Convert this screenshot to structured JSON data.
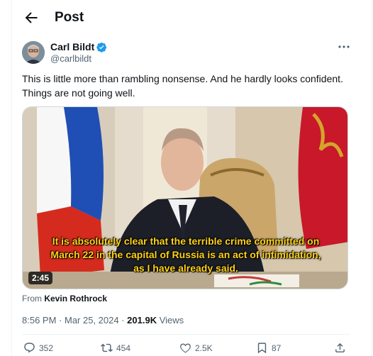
{
  "header": {
    "title": "Post"
  },
  "author": {
    "name": "Carl Bildt",
    "handle": "@carlbildt"
  },
  "tweet": {
    "text": "This is little more than rambling nonsense. And he hardly looks confident. Things are not going well."
  },
  "media": {
    "subtitle_lines": [
      "It is absolutely clear that the terrible crime committed on",
      "March 22 in the capital of Russia is an act of intimidation,",
      "as I have already said."
    ],
    "duration": "2:45",
    "from_prefix": "From ",
    "from_name": "Kevin Rothrock"
  },
  "meta": {
    "time": "8:56 PM",
    "sep1": " · ",
    "date": "Mar 25, 2024",
    "sep2": " · ",
    "views": "201.9K",
    "views_label": " Views"
  },
  "actions": {
    "replies": "352",
    "reposts": "454",
    "likes": "2.5K",
    "bookmarks": "87"
  },
  "colors": {
    "verified": "#1d9bf0",
    "subtitle": "#ffd21a"
  }
}
